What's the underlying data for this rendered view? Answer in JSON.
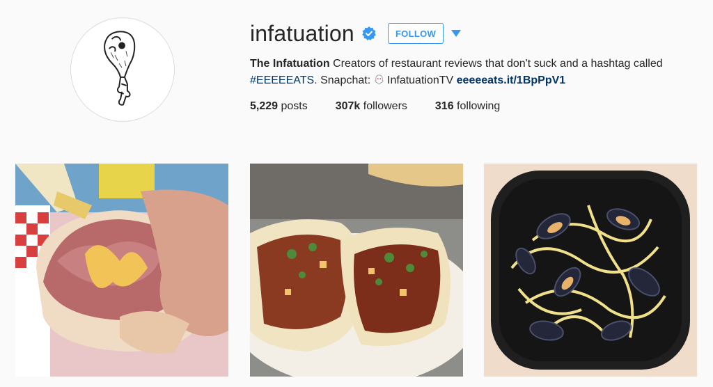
{
  "profile": {
    "username": "infatuation",
    "follow_label": "FOLLOW",
    "bio": {
      "name": "The Infatuation",
      "text1": " Creators of restaurant reviews that don't suck and a hashtag called ",
      "hashtag": "#EEEEEATS",
      "text2": ". Snapchat: ",
      "snapchat_icon": "ghost-icon",
      "snapchat_name": " InfatuationTV ",
      "link": "eeeeeats.it/1BpPpV1"
    },
    "stats": {
      "posts_count": "5,229",
      "posts_label": " posts",
      "followers_count": "307k",
      "followers_label": " followers",
      "following_count": "316",
      "following_label": " following"
    }
  },
  "colors": {
    "accent": "#3897f0",
    "link": "#003569"
  },
  "posts": [
    {
      "subject": "pastrami sandwich with mustard"
    },
    {
      "subject": "tacos al pastor"
    },
    {
      "subject": "mussels with spaghetti"
    }
  ]
}
